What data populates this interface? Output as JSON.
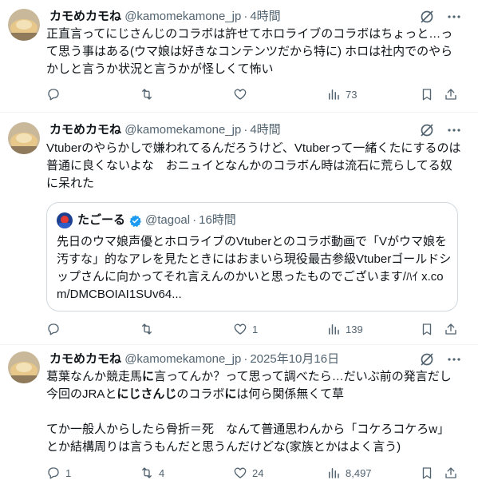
{
  "tweets": [
    {
      "name": "カモめカモね",
      "handle": "@kamomekamone_jp",
      "time": "4時間",
      "text": "正直言ってにじさんじのコラボは許せてホロライブのコラボはちょっと…って思う事はある(ウマ娘は好きなコンテンツだから特に) ホロは社内でのやらかしと言うか状況と言うかが怪しくて怖い",
      "replies": "",
      "retweets": "",
      "likes": "",
      "views": "73"
    },
    {
      "name": "カモめカモね",
      "handle": "@kamomekamone_jp",
      "time": "4時間",
      "text": "Vtuberのやらかしで嫌われてるんだろうけど、Vtuberって一緒くたにするのは普通に良くないよな　おニュイとなんかのコラボん時は流石に荒らしてる奴に呆れた",
      "replies": "",
      "retweets": "",
      "likes": "1",
      "views": "139",
      "quote": {
        "name": "たごーる",
        "handle": "@tagoal",
        "time": "16時間",
        "text": "先日のウマ娘声優とホロライブのVtuberとのコラボ動画で「Vがウマ娘を汚すな」的なアレを見たときにはおまいら現役最古参級Vtuberゴールドシップさんに向かってそれ言えんのかいと思ったものでございます/ﾊｲ x.com/DMCBOIAI1SUv64..."
      }
    },
    {
      "name": "カモめカモね",
      "handle": "@kamomekamone_jp",
      "time": "2025年10月16日",
      "text_part1": "葛葉なんか競走馬",
      "text_bold1": "に",
      "text_part2": "言ってんか？って思って調べたら…だいぶ前の発言だし今回のJRAと",
      "text_bold2": "にじさんじ",
      "text_part3": "のコラボ",
      "text_bold3": "に",
      "text_part4": "は何ら関係無くて草\n\nてか一般人からしたら骨折＝死　なんて普通思わんから「コケろコケろw」とか結構周りは言うもんだと思うんだけどな(家族とかはよく言う)",
      "replies": "1",
      "retweets": "4",
      "likes": "24",
      "views": "8,497"
    }
  ],
  "icons": {
    "grok": "grok-icon",
    "more": "more-icon",
    "reply": "reply-icon",
    "retweet": "retweet-icon",
    "like": "like-icon",
    "views": "views-icon",
    "bookmark": "bookmark-icon",
    "share": "share-icon",
    "verified": "verified-badge-icon"
  },
  "colors": {
    "text": "#0f1419",
    "secondary": "#536471",
    "border": "#cfd9de",
    "verified": "#1d9bf0"
  }
}
